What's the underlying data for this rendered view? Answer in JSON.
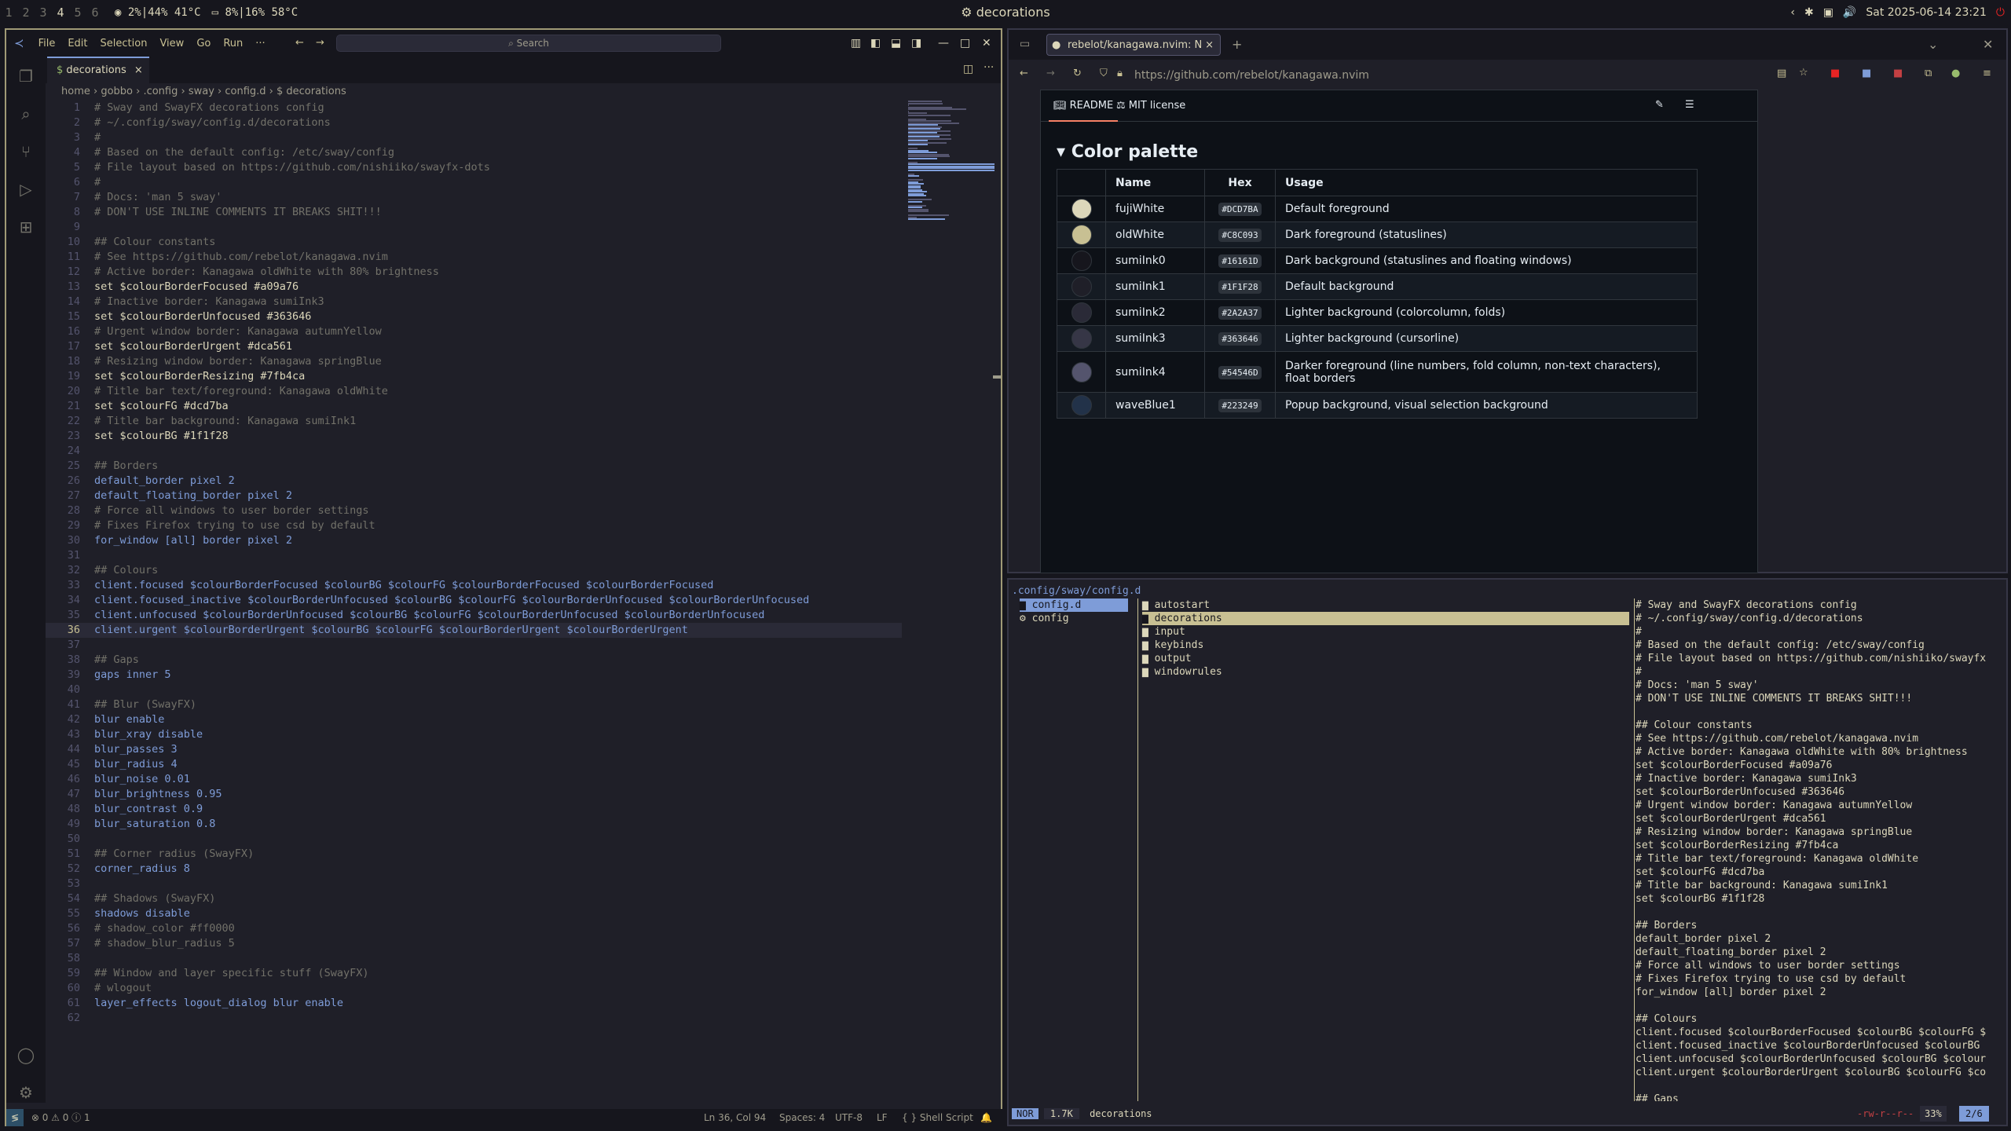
{
  "bar": {
    "workspaces": [
      "1",
      "2",
      "3",
      "4",
      "5",
      "6"
    ],
    "cpu": "2%|44% 41°C",
    "gpu": "8%|16% 58°C",
    "title": "decorations",
    "date": "Sat 2025-06-14 23:21"
  },
  "vscode": {
    "menu": [
      "File",
      "Edit",
      "Selection",
      "View",
      "Go",
      "Run",
      "···"
    ],
    "search": "Search",
    "tab": "decorations",
    "breadcrumb": "home › gobbo › .config › sway › config.d › $ decorations",
    "lines": [
      [
        "c",
        "# Sway and SwayFX decorations config"
      ],
      [
        "c",
        "# ~/.config/sway/config.d/decorations"
      ],
      [
        "c",
        "#"
      ],
      [
        "c",
        "# Based on the default config: /etc/sway/config"
      ],
      [
        "c",
        "# File layout based on https://github.com/nishiiko/swayfx-dots"
      ],
      [
        "c",
        "#"
      ],
      [
        "c",
        "# Docs: 'man 5 sway'"
      ],
      [
        "c",
        "# DON'T USE INLINE COMMENTS IT BREAKS SHIT!!!"
      ],
      [
        "e",
        ""
      ],
      [
        "c",
        "## Colour constants"
      ],
      [
        "c",
        "# See https://github.com/rebelot/kanagawa.nvim"
      ],
      [
        "c",
        "# Active border: Kanagawa oldWhite with 80% brightness"
      ],
      [
        "set",
        "set $colourBorderFocused #a09a76"
      ],
      [
        "c",
        "# Inactive border: Kanagawa sumiInk3"
      ],
      [
        "set",
        "set $colourBorderUnfocused #363646"
      ],
      [
        "c",
        "# Urgent window border: Kanagawa autumnYellow"
      ],
      [
        "set",
        "set $colourBorderUrgent #dca561"
      ],
      [
        "c",
        "# Resizing window border: Kanagawa springBlue"
      ],
      [
        "set",
        "set $colourBorderResizing #7fb4ca"
      ],
      [
        "c",
        "# Title bar text/foreground: Kanagawa oldWhite"
      ],
      [
        "set",
        "set $colourFG #dcd7ba"
      ],
      [
        "c",
        "# Title bar background: Kanagawa sumiInk1"
      ],
      [
        "set",
        "set $colourBG #1f1f28"
      ],
      [
        "e",
        ""
      ],
      [
        "c",
        "## Borders"
      ],
      [
        "k",
        "default_border pixel 2"
      ],
      [
        "k",
        "default_floating_border pixel 2"
      ],
      [
        "c",
        "# Force all windows to user border settings"
      ],
      [
        "c",
        "# Fixes Firefox trying to use csd by default"
      ],
      [
        "k",
        "for_window [all] border pixel 2"
      ],
      [
        "e",
        ""
      ],
      [
        "c",
        "## Colours"
      ],
      [
        "k",
        "client.focused $colourBorderFocused $colourBG $colourFG $colourBorderFocused $colourBorderFocused"
      ],
      [
        "k",
        "client.focused_inactive $colourBorderUnfocused $colourBG $colourFG $colourBorderUnfocused $colourBorderUnfocused"
      ],
      [
        "k",
        "client.unfocused $colourBorderUnfocused $colourBG $colourFG $colourBorderUnfocused $colourBorderUnfocused"
      ],
      [
        "k",
        "client.urgent $colourBorderUrgent $colourBG $colourFG $colourBorderUrgent $colourBorderUrgent"
      ],
      [
        "e",
        ""
      ],
      [
        "c",
        "## Gaps"
      ],
      [
        "k",
        "gaps inner 5"
      ],
      [
        "e",
        ""
      ],
      [
        "c",
        "## Blur (SwayFX)"
      ],
      [
        "k",
        "blur enable"
      ],
      [
        "k",
        "blur_xray disable"
      ],
      [
        "k",
        "blur_passes 3"
      ],
      [
        "k",
        "blur_radius 4"
      ],
      [
        "k",
        "blur_noise 0.01"
      ],
      [
        "k",
        "blur_brightness 0.95"
      ],
      [
        "k",
        "blur_contrast 0.9"
      ],
      [
        "k",
        "blur_saturation 0.8"
      ],
      [
        "e",
        ""
      ],
      [
        "c",
        "## Corner radius (SwayFX)"
      ],
      [
        "k",
        "corner_radius 8"
      ],
      [
        "e",
        ""
      ],
      [
        "c",
        "## Shadows (SwayFX)"
      ],
      [
        "k",
        "shadows disable"
      ],
      [
        "c",
        "# shadow_color #ff0000"
      ],
      [
        "c",
        "# shadow_blur_radius 5"
      ],
      [
        "e",
        ""
      ],
      [
        "c",
        "## Window and layer specific stuff (SwayFX)"
      ],
      [
        "c",
        "# wlogout"
      ],
      [
        "k",
        "layer_effects logout_dialog blur enable"
      ],
      [
        "e",
        ""
      ]
    ],
    "current_line": 36,
    "status": {
      "problems": "⊗ 0 ⚠ 0 ⓘ 1",
      "position": "Ln 36, Col 94",
      "spaces": "Spaces: 4",
      "encoding": "UTF-8",
      "eol": "LF",
      "lang": "{ } Shell Script"
    }
  },
  "firefox": {
    "tab": "rebelot/kanagawa.nvim: N",
    "url": "https://github.com/rebelot/kanagawa.nvim",
    "readme_tab": "README",
    "license_tab": "MIT license",
    "heading": "Color palette",
    "columns": [
      "",
      "Name",
      "Hex",
      "Usage"
    ],
    "rows": [
      {
        "color": "#DCD7BA",
        "name": "fujiWhite",
        "hex": "#DCD7BA",
        "usage": "Default foreground"
      },
      {
        "color": "#C8C093",
        "name": "oldWhite",
        "hex": "#C8C093",
        "usage": "Dark foreground (statuslines)"
      },
      {
        "color": "#16161D",
        "name": "sumiInk0",
        "hex": "#16161D",
        "usage": "Dark background (statuslines and floating windows)"
      },
      {
        "color": "#1F1F28",
        "name": "sumiInk1",
        "hex": "#1F1F28",
        "usage": "Default background"
      },
      {
        "color": "#2A2A37",
        "name": "sumiInk2",
        "hex": "#2A2A37",
        "usage": "Lighter background (colorcolumn, folds)"
      },
      {
        "color": "#363646",
        "name": "sumiInk3",
        "hex": "#363646",
        "usage": "Lighter background (cursorline)"
      },
      {
        "color": "#54546D",
        "name": "sumiInk4",
        "hex": "#54546D",
        "usage": "Darker foreground (line numbers, fold column, non-text characters), float borders"
      },
      {
        "color": "#223249",
        "name": "waveBlue1",
        "hex": "#223249",
        "usage": "Popup background, visual selection background"
      }
    ]
  },
  "terminal": {
    "path": ".config/sway/config.d",
    "parent": [
      "config.d",
      "config"
    ],
    "files": [
      "autostart",
      "decorations",
      "input",
      "keybinds",
      "output",
      "windowrules"
    ],
    "preview": [
      "# Sway and SwayFX decorations config",
      "# ~/.config/sway/config.d/decorations",
      "#",
      "# Based on the default config: /etc/sway/config",
      "# File layout based on https://github.com/nishiiko/swayfx",
      "#",
      "# Docs: 'man 5 sway'",
      "# DON'T USE INLINE COMMENTS IT BREAKS SHIT!!!",
      "",
      "## Colour constants",
      "# See https://github.com/rebelot/kanagawa.nvim",
      "# Active border: Kanagawa oldWhite with 80% brightness",
      "set $colourBorderFocused #a09a76",
      "# Inactive border: Kanagawa sumiInk3",
      "set $colourBorderUnfocused #363646",
      "# Urgent window border: Kanagawa autumnYellow",
      "set $colourBorderUrgent #dca561",
      "# Resizing window border: Kanagawa springBlue",
      "set $colourBorderResizing #7fb4ca",
      "# Title bar text/foreground: Kanagawa oldWhite",
      "set $colourFG #dcd7ba",
      "# Title bar background: Kanagawa sumiInk1",
      "set $colourBG #1f1f28",
      "",
      "## Borders",
      "default_border pixel 2",
      "default_floating_border pixel 2",
      "# Force all windows to user border settings",
      "# Fixes Firefox trying to use csd by default",
      "for_window [all] border pixel 2",
      "",
      "## Colours",
      "client.focused $colourBorderFocused $colourBG $colourFG $",
      "client.focused_inactive $colourBorderUnfocused $colourBG",
      "client.unfocused $colourBorderUnfocused $colourBG $colour",
      "client.urgent $colourBorderUrgent $colourBG $colourFG $co",
      "",
      "## Gaps"
    ],
    "mode": "NOR",
    "size": "1.7K",
    "file": "decorations",
    "perms": "-rw-r--r--",
    "percent": "33%",
    "pos": "2/6"
  }
}
